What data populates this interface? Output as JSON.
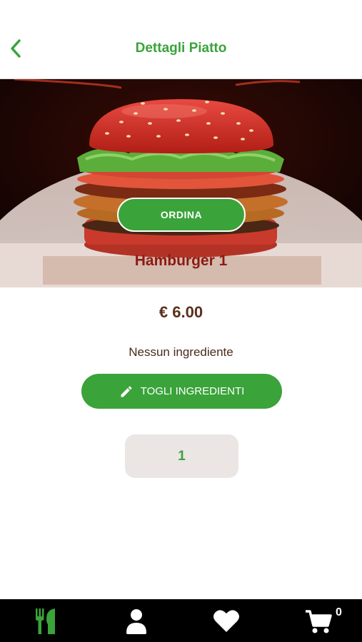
{
  "header": {
    "title": "Dettagli Piatto"
  },
  "item": {
    "order_label": "ORDINA",
    "name": "Hamburger 1",
    "price": "€ 6.00",
    "ingredients_text": "Nessun ingrediente",
    "remove_ingredients_label": "TOGLI INGREDIENTI",
    "quantity": "1"
  },
  "tabbar": {
    "cart_count": "0"
  },
  "colors": {
    "accent": "#3aa33a",
    "item_name": "#8c1b12",
    "price": "#5a2f1a"
  }
}
